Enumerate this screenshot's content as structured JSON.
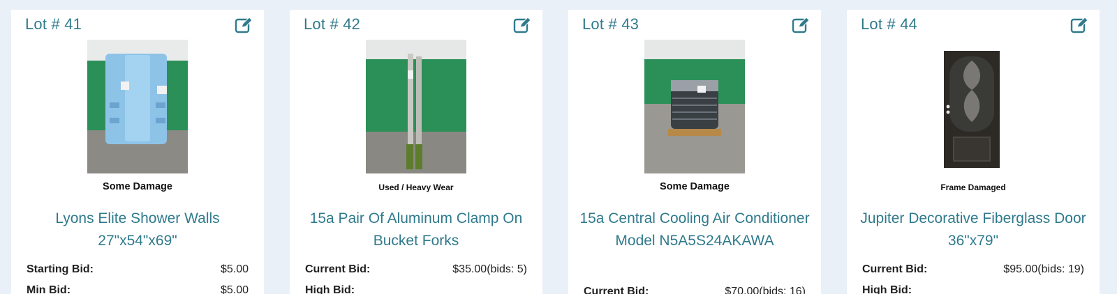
{
  "colors": {
    "background": "#eaf0f7",
    "accent": "#2f7a8c"
  },
  "lots": [
    {
      "lot": "Lot # 41",
      "condition": "Some Damage",
      "title": "Lyons Elite Shower Walls 27\"x54\"x69\"",
      "bid_label": "Starting Bid:",
      "bid_value": "$5.00",
      "next_label": "Min Bid:",
      "next_value": "$5.00",
      "image_icon": "shower-walls-photo"
    },
    {
      "lot": "Lot # 42",
      "condition": "Used / Heavy Wear",
      "title": "15a Pair Of Aluminum Clamp On Bucket Forks",
      "bid_label": "Current Bid:",
      "bid_value": "$35.00(bids: 5)",
      "next_label": "High Bid:",
      "next_value": "",
      "image_icon": "bucket-forks-photo"
    },
    {
      "lot": "Lot # 43",
      "condition": "Some Damage",
      "title": "15a Central Cooling Air Conditioner Model N5A5S24AKAWA",
      "bid_label": "Current Bid:",
      "bid_value": "$70.00(bids: 16)",
      "next_label": "",
      "next_value": "",
      "image_icon": "air-conditioner-photo"
    },
    {
      "lot": "Lot # 44",
      "condition": "Frame Damaged",
      "title": "Jupiter Decorative Fiberglass Door 36\"x79\"",
      "bid_label": "Current Bid:",
      "bid_value": "$95.00(bids: 19)",
      "next_label": "High Bid:",
      "next_value": "",
      "image_icon": "fiberglass-door-photo"
    }
  ]
}
